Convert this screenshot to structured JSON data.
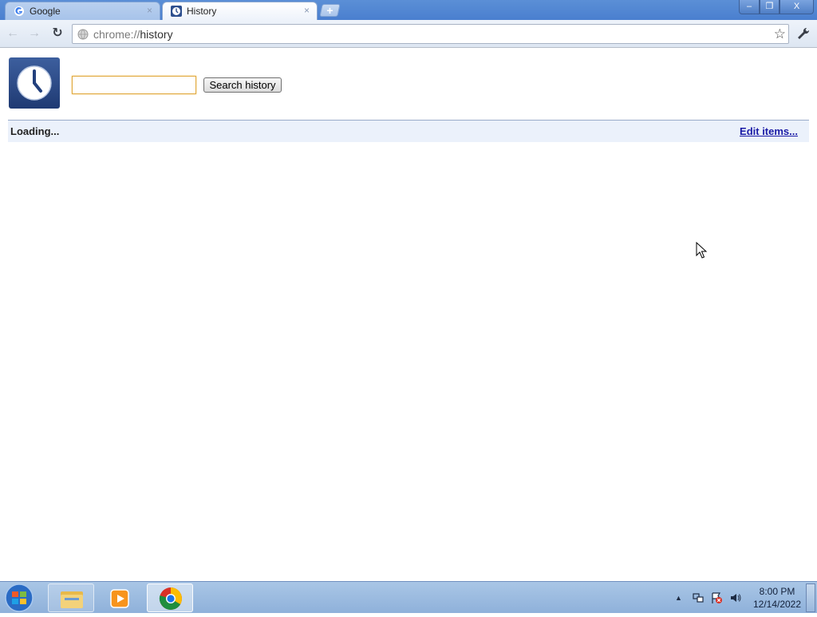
{
  "tabs": [
    {
      "title": "Google",
      "icon": "google-g-icon",
      "close": "×"
    },
    {
      "title": "History",
      "icon": "history-clock-icon",
      "close": "×"
    }
  ],
  "new_tab_label": "+",
  "window_controls": {
    "minimize": "–",
    "maximize": "❐",
    "close": "X"
  },
  "toolbar": {
    "back": "←",
    "forward": "→",
    "reload": "↻",
    "url_scheme": "chrome://",
    "url_host": "history",
    "star": "☆",
    "wrench": "🔧"
  },
  "history_page": {
    "search_value": "",
    "search_button": "Search history",
    "loading": "Loading...",
    "edit_items": "Edit items..."
  },
  "taskbar": {
    "tray_arrow": "▲",
    "time": "8:00 PM",
    "date": "12/14/2022"
  },
  "colors": {
    "chrome_frame": "#4a7fcf",
    "results_header_bg": "#ebf1fb",
    "link": "#1a1aa6",
    "taskbar": "#9cbbe0"
  }
}
